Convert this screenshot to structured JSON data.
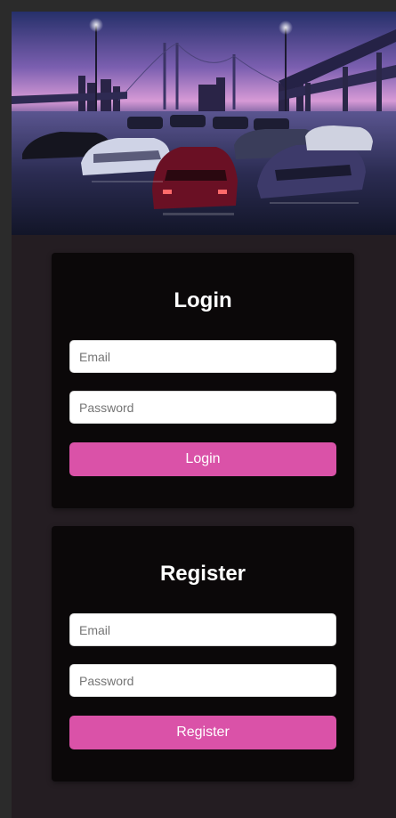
{
  "banner": {
    "alt": "Night city parking lot with lineup of tuned sports cars under a bridge"
  },
  "login": {
    "title": "Login",
    "email_placeholder": "Email",
    "password_placeholder": "Password",
    "button_label": "Login"
  },
  "register": {
    "title": "Register",
    "email_placeholder": "Email",
    "password_placeholder": "Password",
    "button_label": "Register"
  },
  "colors": {
    "accent": "#da52a8",
    "card_bg": "#0b0809",
    "page_bg": "#241d22",
    "frame_bg": "#2b2b2b"
  }
}
